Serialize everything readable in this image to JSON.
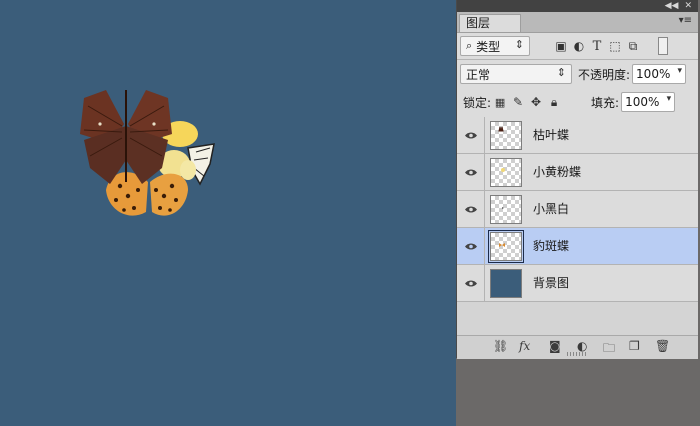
{
  "panel": {
    "tab_label": "图层",
    "strip_icons": [
      "collapse-icon",
      "close-icon"
    ],
    "tab_menu_icon": "panel-menu-icon"
  },
  "filter": {
    "search_icon": "search-icon",
    "kind_value": "类型",
    "filter_icons": [
      "image-filter-icon",
      "adjustment-filter-icon",
      "type-filter-icon",
      "shape-filter-icon",
      "smart-object-filter-icon"
    ],
    "T_glyph": "T"
  },
  "blend": {
    "mode_value": "正常",
    "opacity_label": "不透明度:",
    "opacity_value": "100%"
  },
  "lock": {
    "label": "锁定:",
    "icons": [
      "lock-transparent-icon",
      "lock-paint-icon",
      "lock-position-icon",
      "lock-all-icon"
    ],
    "fill_label": "填充:",
    "fill_value": "100%"
  },
  "layers": [
    {
      "name": "枯叶蝶",
      "selected": false,
      "thumb": "dead-leaf-butterfly"
    },
    {
      "name": "小黄粉蝶",
      "selected": false,
      "thumb": "yellow-butterfly"
    },
    {
      "name": "小黑白",
      "selected": false,
      "thumb": "black-white-butterfly"
    },
    {
      "name": "豹斑蝶",
      "selected": true,
      "thumb": "leopard-butterfly"
    },
    {
      "name": "背景图",
      "selected": false,
      "thumb": "background-solid"
    }
  ],
  "footer": {
    "icons": [
      "link-icon",
      "fx-icon",
      "mask-icon",
      "adjustment-icon",
      "group-icon",
      "new-layer-icon",
      "delete-icon"
    ],
    "fx_label": "fx"
  },
  "colors": {
    "canvas": "#3b5d7a",
    "selected_layer": "#b9cdf3",
    "panel_bg": "#dcdcdc"
  }
}
